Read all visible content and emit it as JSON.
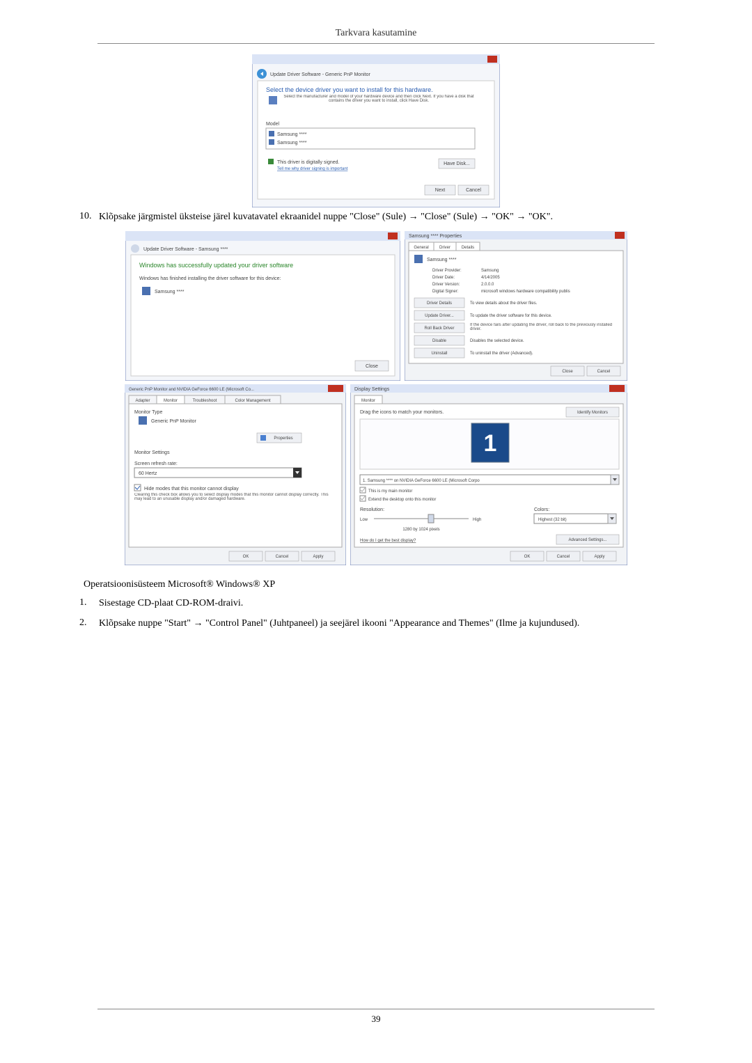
{
  "doc": {
    "header": "Tarkvara kasutamine",
    "page_number": "39"
  },
  "step10": {
    "num": "10.",
    "text": "Klõpsake järgmistel üksteise järel kuvatavatel ekraanidel nuppe \"Close\" (Sule) → \"Close\" (Sule) → \"OK\" → \"OK\"."
  },
  "os_title": "Operatsioonisüsteem Microsoft® Windows® XP",
  "step1": {
    "num": "1.",
    "text": "Sisestage CD-plaat CD-ROM-draivi."
  },
  "step2": {
    "num": "2.",
    "text": "Klõpsake nuppe \"Start\" → \"Control Panel\" (Juhtpaneel) ja seejärel ikooni \"Appearance and Themes\" (Ilme ja kujundused)."
  },
  "dlg_select": {
    "breadcrumb": "Update Driver Software - Generic PnP Monitor",
    "title": "Select the device driver you want to install for this hardware.",
    "subtext": "Select the manufacturer and model of your hardware device and then click Next. If you have a disk that contains the driver you want to install, click Have Disk.",
    "model_label": "Model",
    "model1": "Samsung ****",
    "model2": "Samsung ****",
    "signed_text": "This driver is digitally signed.",
    "signed_link": "Tell me why driver signing is important",
    "have_disk": "Have Disk...",
    "next": "Next",
    "cancel": "Cancel"
  },
  "dlg_success": {
    "breadcrumb": "Update Driver Software - Samsung ****",
    "title": "Windows has successfully updated your driver software",
    "subtext": "Windows has finished installing the driver software for this device:",
    "model": "Samsung ****",
    "close": "Close"
  },
  "dlg_props": {
    "title": "Samsung **** Properties",
    "tab_general": "General",
    "tab_driver": "Driver",
    "tab_details": "Details",
    "device": "Samsung ****",
    "provider_lbl": "Driver Provider:",
    "provider": "Samsung",
    "date_lbl": "Driver Date:",
    "date": "4/14/2005",
    "ver_lbl": "Driver Version:",
    "ver": "2.0.0.0",
    "signer_lbl": "Digital Signer:",
    "signer": "microsoft windows hardware compatibility publis",
    "btn_details": "Driver Details",
    "btn_details_txt": "To view details about the driver files.",
    "btn_update": "Update Driver...",
    "btn_update_txt": "To update the driver software for this device.",
    "btn_rollback": "Roll Back Driver",
    "btn_rollback_txt": "If the device fails after updating the driver, roll back to the previously installed driver.",
    "btn_disable": "Disable",
    "btn_disable_txt": "Disables the selected device.",
    "btn_uninstall": "Uninstall",
    "btn_uninstall_txt": "To uninstall the driver (Advanced).",
    "close": "Close",
    "cancel": "Cancel"
  },
  "dlg_monitor": {
    "title": "Generic PnP Monitor and NVIDIA GeForce 6600 LE (Microsoft Co...",
    "tab_adapter": "Adapter",
    "tab_monitor": "Monitor",
    "tab_trouble": "Troubleshoot",
    "tab_color": "Color Management",
    "type_label": "Monitor Type",
    "type_value": "Generic PnP Monitor",
    "props_btn": "Properties",
    "settings_label": "Monitor Settings",
    "refresh_label": "Screen refresh rate:",
    "refresh_value": "60 Hertz",
    "hide_check": "Hide modes that this monitor cannot display",
    "hide_text": "Clearing this check box allows you to select display modes that this monitor cannot display correctly. This may lead to an unusable display and/or damaged hardware.",
    "ok": "OK",
    "cancel": "Cancel",
    "apply": "Apply"
  },
  "dlg_display": {
    "title": "Display Settings",
    "tab_monitor": "Monitor",
    "drag_text": "Drag the icons to match your monitors.",
    "identify": "Identify Monitors",
    "big_one": "1",
    "dd_value": "1. Samsung **** on NVIDIA GeForce 6600 LE (Microsoft Corpo",
    "chk_main": "This is my main monitor",
    "chk_extend": "Extend the desktop onto this monitor",
    "res_label": "Resolution:",
    "low": "Low",
    "high": "High",
    "res_value": "1280 by 1024 pixels",
    "colors_label": "Colors:",
    "colors_value": "Highest (32 bit)",
    "howto": "How do I get the best display?",
    "advanced": "Advanced Settings...",
    "ok": "OK",
    "cancel": "Cancel",
    "apply": "Apply"
  }
}
